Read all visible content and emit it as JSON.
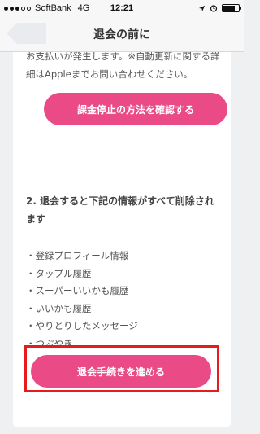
{
  "status_bar": {
    "carrier": "SoftBank",
    "network": "4G",
    "time": "12:21"
  },
  "nav": {
    "title": "退会の前に"
  },
  "notice": {
    "text": "お支払いが発生します。※自動更新に関する詳細はAppleまでお問い合わせください。"
  },
  "buttons": {
    "billing_stop": "課金停止の方法を確認する",
    "proceed": "退会手続きを進める"
  },
  "section2": {
    "title": "2. 退会すると下記の情報がすべて削除されます",
    "items": [
      "・登録プロフィール情報",
      "・タップル履歴",
      "・スーパーいいかも履歴",
      "・いいかも履歴",
      "・やりとりしたメッセージ",
      "・つぶやき"
    ]
  },
  "colors": {
    "accent": "#ea4b87",
    "highlight": "#e61b1b"
  }
}
